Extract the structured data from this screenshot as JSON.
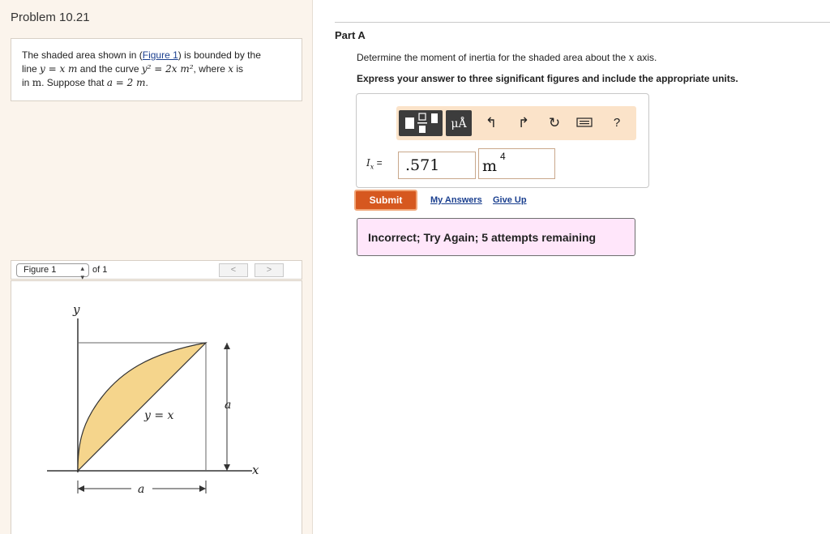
{
  "problem": {
    "title": "Problem 10.21",
    "statement": {
      "part1": "The shaded area shown in (",
      "figure_link": "Figure 1",
      "part2": ") is bounded by the",
      "line2_a": "line ",
      "line_eq": "y = x m",
      "line2_b": " and the curve ",
      "curve_eq": "y² = 2x m²",
      "line2_c": ", where ",
      "var_x": "x",
      "line2_d": " is",
      "line3_a": "in ",
      "unit_m": "m",
      "line3_b": ". Suppose that ",
      "a_eq": "a = 2 m",
      "line3_c": "."
    }
  },
  "figure_nav": {
    "selected": "Figure 1",
    "of_text": "of 1",
    "prev": "<",
    "next": ">"
  },
  "figure": {
    "y_axis_label": "y",
    "x_axis_label": "x",
    "line_label": "y = x",
    "dim_a_vertical": "a",
    "dim_a_horizontal": "a",
    "fill_color": "#f5d58c"
  },
  "part": {
    "title": "Part A",
    "prompt_a": "Determine the moment of inertia for the shaded area about the ",
    "prompt_var": "x",
    "prompt_b": " axis.",
    "instruction": "Express your answer to three significant figures and include the appropriate units."
  },
  "toolbar": {
    "template_icon": "fraction-template-icon",
    "units_label": "μÅ",
    "undo_icon": "undo-arrow-icon",
    "redo_icon": "redo-arrow-icon",
    "reset_icon": "reset-icon",
    "keyboard_icon": "keyboard-icon",
    "help_label": "?"
  },
  "answer": {
    "label_var": "I",
    "label_sub": "x",
    "label_eq": " =",
    "value": ".571",
    "unit": "m",
    "unit_exp": "4"
  },
  "actions": {
    "submit": "Submit",
    "my_answers": "My Answers",
    "give_up": "Give Up"
  },
  "feedback": {
    "message": "Incorrect; Try Again; 5 attempts remaining"
  },
  "colors": {
    "accent": "#d6581f",
    "feedback_bg": "#ffe6fa",
    "toolbar_bg": "#fbe3c9",
    "left_panel_bg": "#fbf4ec"
  }
}
